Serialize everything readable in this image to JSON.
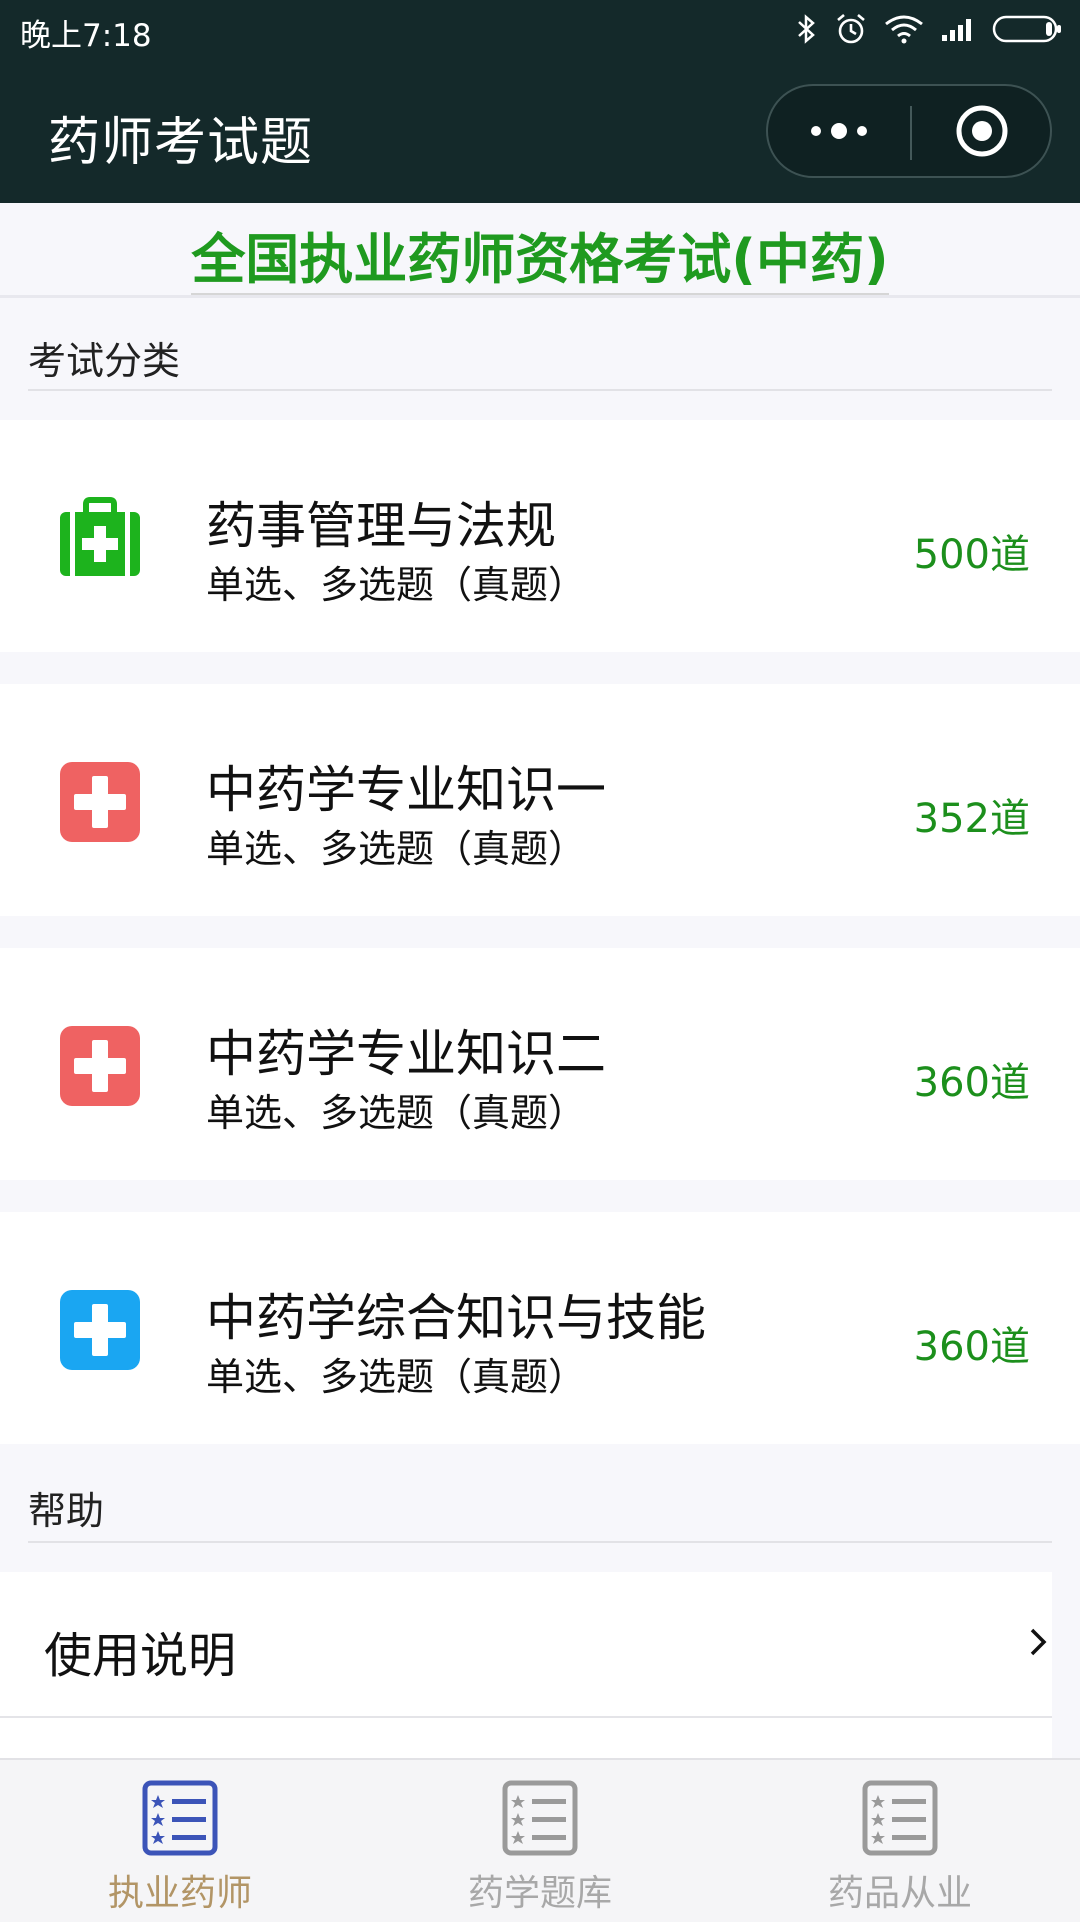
{
  "status": {
    "time": "晚上7:18"
  },
  "header": {
    "title": "药师考试题"
  },
  "banner": {
    "title": "全国执业药师资格考试(中药)"
  },
  "sections": {
    "exam_category": "考试分类",
    "help": "帮助"
  },
  "exams": [
    {
      "name": "药事管理与法规",
      "subtitle": "单选、多选题（真题）",
      "count": "500道",
      "icon": "medical-kit-icon",
      "color": "#1db31d"
    },
    {
      "name": "中药学专业知识一",
      "subtitle": "单选、多选题（真题）",
      "count": "352道",
      "icon": "medical-cross-icon",
      "color": "#ef6262"
    },
    {
      "name": "中药学专业知识二",
      "subtitle": "单选、多选题（真题）",
      "count": "360道",
      "icon": "medical-cross-icon",
      "color": "#ef6262"
    },
    {
      "name": "中药学综合知识与技能",
      "subtitle": "单选、多选题（真题）",
      "count": "360道",
      "icon": "medical-cross-icon",
      "color": "#1aa6f2"
    }
  ],
  "help": {
    "usage": "使用说明"
  },
  "tabs": [
    {
      "label": "执业药师",
      "active": true,
      "color": "#b29566",
      "icon_color": "#3c54b8"
    },
    {
      "label": "药学题库",
      "active": false,
      "color": "#a8a8a8",
      "icon_color": "#9a9a9a"
    },
    {
      "label": "药品从业",
      "active": false,
      "color": "#a8a8a8",
      "icon_color": "#9a9a9a"
    }
  ]
}
